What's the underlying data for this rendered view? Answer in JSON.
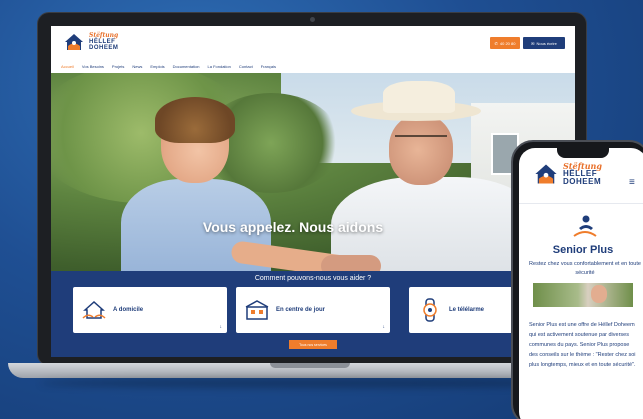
{
  "brand": {
    "line1": "Stëftung",
    "line2": "HËLLEF",
    "line3": "DOHEEM"
  },
  "header": {
    "phone_label": "40 20 80",
    "account_label": "Nous écrire"
  },
  "nav": {
    "items": [
      "Accueil",
      "Vos Besoins",
      "Projets",
      "News",
      "Emplois",
      "Documentation",
      "La Fondation",
      "Contact",
      "Français"
    ]
  },
  "hero": {
    "title": "Vous appelez. Nous aidons"
  },
  "help": {
    "title": "Comment pouvons-nous vous aider ?",
    "cards": [
      {
        "label": "A domicile",
        "icon": "house-hands-icon"
      },
      {
        "label": "En centre de jour",
        "icon": "day-center-icon"
      },
      {
        "label": "Le télélarme",
        "icon": "alarm-watch-icon"
      }
    ],
    "cta": "Tous nos services",
    "arrow": "↓"
  },
  "phone": {
    "menu_glyph": "≡",
    "title": "Senior Plus",
    "subtitle": "Restez chez vous confortablement et en toute sécurité",
    "body": "Senior Plus est une offre de Hëllef Doheem qui est activement soutenue par diverses communes du pays. Senior Plus propose des conseils sur le thème : \"Rester chez soi plus longtemps, mieux et en toute sécurité\"."
  },
  "colors": {
    "brand_blue": "#1f3d7a",
    "brand_orange": "#ef7d2c",
    "background": "#1f4f93"
  }
}
